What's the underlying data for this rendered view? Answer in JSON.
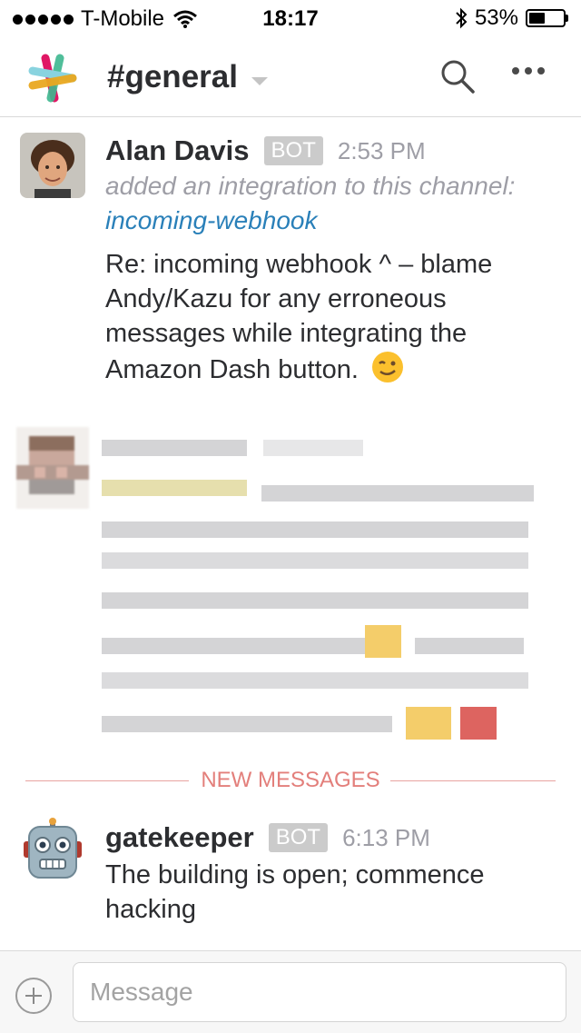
{
  "status_bar": {
    "carrier": "T-Mobile",
    "time": "18:17",
    "battery_percent": "53%",
    "battery_level": 0.53
  },
  "header": {
    "channel": "#general"
  },
  "messages": [
    {
      "author": "Alan Davis",
      "badge": "BOT",
      "time": "2:53 PM",
      "system_text": "added an integration to this channel:",
      "link": "incoming-webhook",
      "text": "Re: incoming webhook ^ – blame Andy/Kazu for any erroneous messages while integrating the Amazon Dash button."
    },
    {
      "author": "gatekeeper",
      "badge": "BOT",
      "time": "6:13 PM",
      "text": "The building is open; commence hacking"
    }
  ],
  "divider": {
    "label": "NEW MESSAGES"
  },
  "composer": {
    "placeholder": "Message"
  },
  "colors": {
    "link": "#2a80b9",
    "divider": "#e37f7b",
    "badge": "#cbcbcb"
  },
  "icons": [
    "wifi-icon",
    "bluetooth-icon",
    "slack-logo",
    "chevron-down-icon",
    "search-icon",
    "more-icon",
    "wink-emoji",
    "robot-icon",
    "plus-icon"
  ]
}
